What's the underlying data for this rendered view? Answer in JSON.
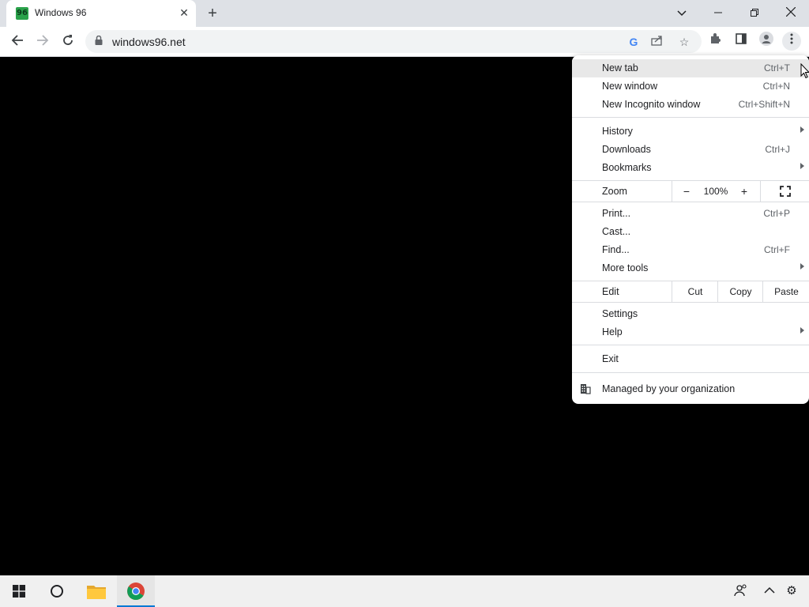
{
  "tab": {
    "title": "Windows 96",
    "favicon": "windows96-favicon",
    "close_icon": "close-icon"
  },
  "window_controls": {
    "tab_search": "chevron-down-icon",
    "minimize": "minimize-icon",
    "restore": "restore-icon",
    "close": "close-icon"
  },
  "toolbar": {
    "url": "windows96.net",
    "back": "back-arrow-icon",
    "forward": "forward-arrow-icon",
    "reload": "reload-icon"
  },
  "menu": {
    "items": [
      {
        "label": "New tab",
        "shortcut": "Ctrl+T"
      },
      {
        "label": "New window",
        "shortcut": "Ctrl+N"
      },
      {
        "label": "New Incognito window",
        "shortcut": "Ctrl+Shift+N"
      },
      {
        "label": "History",
        "shortcut": ""
      },
      {
        "label": "Downloads",
        "shortcut": "Ctrl+J"
      },
      {
        "label": "Bookmarks",
        "shortcut": ""
      },
      {
        "label": "Print...",
        "shortcut": "Ctrl+P"
      },
      {
        "label": "Cast...",
        "shortcut": ""
      },
      {
        "label": "Find...",
        "shortcut": "Ctrl+F"
      },
      {
        "label": "More tools",
        "shortcut": ""
      },
      {
        "label": "Settings",
        "shortcut": ""
      },
      {
        "label": "Help",
        "shortcut": ""
      },
      {
        "label": "Exit",
        "shortcut": ""
      }
    ],
    "zoom": {
      "label": "Zoom",
      "minus": "−",
      "value": "100%",
      "plus": "+"
    },
    "edit": {
      "label": "Edit",
      "cut": "Cut",
      "copy": "Copy",
      "paste": "Paste"
    },
    "managed": "Managed by your organization"
  },
  "colors": {
    "accent": "#0078d4",
    "favicon": "#2aa24a",
    "taskbar": "#f0f0f0"
  }
}
